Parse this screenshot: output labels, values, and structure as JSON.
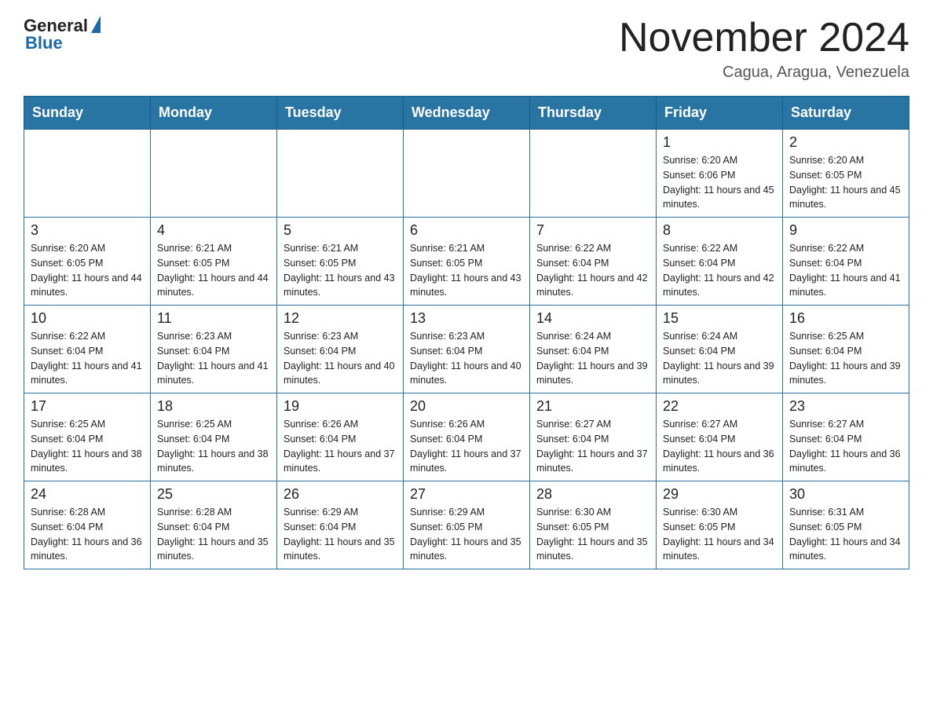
{
  "header": {
    "logo_general": "General",
    "logo_blue": "Blue",
    "month_title": "November 2024",
    "location": "Cagua, Aragua, Venezuela"
  },
  "days_of_week": [
    "Sunday",
    "Monday",
    "Tuesday",
    "Wednesday",
    "Thursday",
    "Friday",
    "Saturday"
  ],
  "weeks": [
    [
      {
        "day": "",
        "info": ""
      },
      {
        "day": "",
        "info": ""
      },
      {
        "day": "",
        "info": ""
      },
      {
        "day": "",
        "info": ""
      },
      {
        "day": "",
        "info": ""
      },
      {
        "day": "1",
        "info": "Sunrise: 6:20 AM\nSunset: 6:06 PM\nDaylight: 11 hours and 45 minutes."
      },
      {
        "day": "2",
        "info": "Sunrise: 6:20 AM\nSunset: 6:05 PM\nDaylight: 11 hours and 45 minutes."
      }
    ],
    [
      {
        "day": "3",
        "info": "Sunrise: 6:20 AM\nSunset: 6:05 PM\nDaylight: 11 hours and 44 minutes."
      },
      {
        "day": "4",
        "info": "Sunrise: 6:21 AM\nSunset: 6:05 PM\nDaylight: 11 hours and 44 minutes."
      },
      {
        "day": "5",
        "info": "Sunrise: 6:21 AM\nSunset: 6:05 PM\nDaylight: 11 hours and 43 minutes."
      },
      {
        "day": "6",
        "info": "Sunrise: 6:21 AM\nSunset: 6:05 PM\nDaylight: 11 hours and 43 minutes."
      },
      {
        "day": "7",
        "info": "Sunrise: 6:22 AM\nSunset: 6:04 PM\nDaylight: 11 hours and 42 minutes."
      },
      {
        "day": "8",
        "info": "Sunrise: 6:22 AM\nSunset: 6:04 PM\nDaylight: 11 hours and 42 minutes."
      },
      {
        "day": "9",
        "info": "Sunrise: 6:22 AM\nSunset: 6:04 PM\nDaylight: 11 hours and 41 minutes."
      }
    ],
    [
      {
        "day": "10",
        "info": "Sunrise: 6:22 AM\nSunset: 6:04 PM\nDaylight: 11 hours and 41 minutes."
      },
      {
        "day": "11",
        "info": "Sunrise: 6:23 AM\nSunset: 6:04 PM\nDaylight: 11 hours and 41 minutes."
      },
      {
        "day": "12",
        "info": "Sunrise: 6:23 AM\nSunset: 6:04 PM\nDaylight: 11 hours and 40 minutes."
      },
      {
        "day": "13",
        "info": "Sunrise: 6:23 AM\nSunset: 6:04 PM\nDaylight: 11 hours and 40 minutes."
      },
      {
        "day": "14",
        "info": "Sunrise: 6:24 AM\nSunset: 6:04 PM\nDaylight: 11 hours and 39 minutes."
      },
      {
        "day": "15",
        "info": "Sunrise: 6:24 AM\nSunset: 6:04 PM\nDaylight: 11 hours and 39 minutes."
      },
      {
        "day": "16",
        "info": "Sunrise: 6:25 AM\nSunset: 6:04 PM\nDaylight: 11 hours and 39 minutes."
      }
    ],
    [
      {
        "day": "17",
        "info": "Sunrise: 6:25 AM\nSunset: 6:04 PM\nDaylight: 11 hours and 38 minutes."
      },
      {
        "day": "18",
        "info": "Sunrise: 6:25 AM\nSunset: 6:04 PM\nDaylight: 11 hours and 38 minutes."
      },
      {
        "day": "19",
        "info": "Sunrise: 6:26 AM\nSunset: 6:04 PM\nDaylight: 11 hours and 37 minutes."
      },
      {
        "day": "20",
        "info": "Sunrise: 6:26 AM\nSunset: 6:04 PM\nDaylight: 11 hours and 37 minutes."
      },
      {
        "day": "21",
        "info": "Sunrise: 6:27 AM\nSunset: 6:04 PM\nDaylight: 11 hours and 37 minutes."
      },
      {
        "day": "22",
        "info": "Sunrise: 6:27 AM\nSunset: 6:04 PM\nDaylight: 11 hours and 36 minutes."
      },
      {
        "day": "23",
        "info": "Sunrise: 6:27 AM\nSunset: 6:04 PM\nDaylight: 11 hours and 36 minutes."
      }
    ],
    [
      {
        "day": "24",
        "info": "Sunrise: 6:28 AM\nSunset: 6:04 PM\nDaylight: 11 hours and 36 minutes."
      },
      {
        "day": "25",
        "info": "Sunrise: 6:28 AM\nSunset: 6:04 PM\nDaylight: 11 hours and 35 minutes."
      },
      {
        "day": "26",
        "info": "Sunrise: 6:29 AM\nSunset: 6:04 PM\nDaylight: 11 hours and 35 minutes."
      },
      {
        "day": "27",
        "info": "Sunrise: 6:29 AM\nSunset: 6:05 PM\nDaylight: 11 hours and 35 minutes."
      },
      {
        "day": "28",
        "info": "Sunrise: 6:30 AM\nSunset: 6:05 PM\nDaylight: 11 hours and 35 minutes."
      },
      {
        "day": "29",
        "info": "Sunrise: 6:30 AM\nSunset: 6:05 PM\nDaylight: 11 hours and 34 minutes."
      },
      {
        "day": "30",
        "info": "Sunrise: 6:31 AM\nSunset: 6:05 PM\nDaylight: 11 hours and 34 minutes."
      }
    ]
  ]
}
